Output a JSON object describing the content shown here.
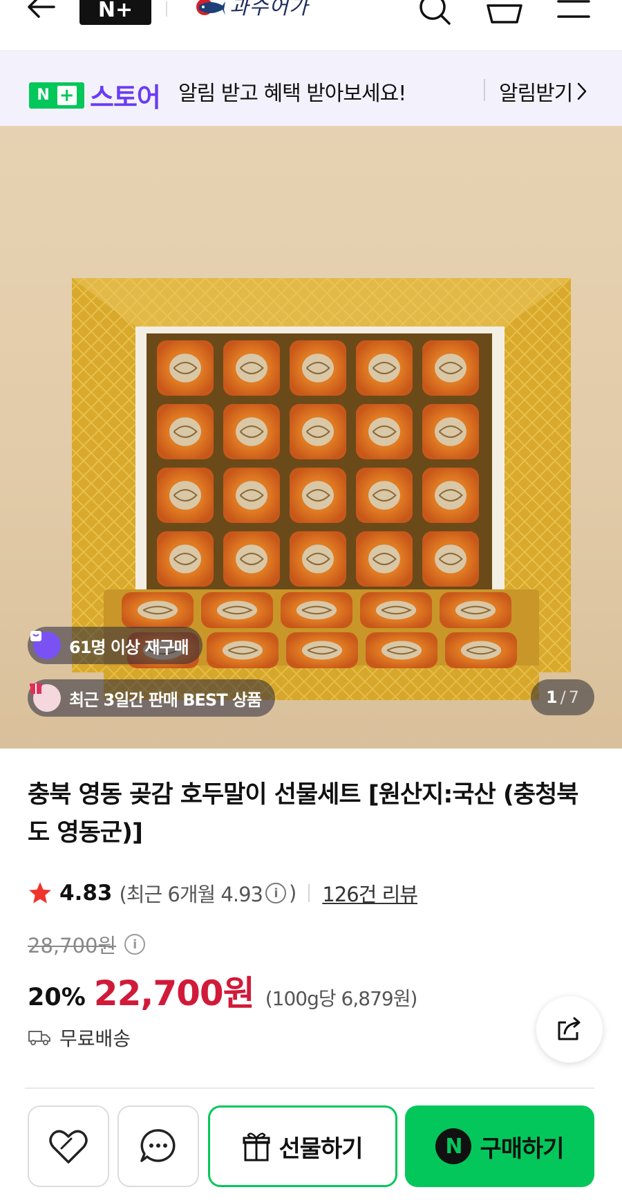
{
  "topnav": {
    "nplus_label": "N+",
    "brand_name": "과수어가",
    "icons": [
      "back-arrow-icon",
      "search-icon",
      "cart-icon",
      "menu-icon"
    ]
  },
  "banner": {
    "logo_n": "N",
    "logo_plus": "+",
    "logo_store": "스토어",
    "message": "알림 받고 혜택 받아보세요!",
    "action": "알림받기"
  },
  "hero": {
    "pill_repurchase": "61명 이상 재구매",
    "pill_best": "최근 3일간 판매 BEST 상품",
    "counter_current": "1",
    "counter_sep": "/",
    "counter_total": "7"
  },
  "product": {
    "title": "충북 영동 곶감 호두말이 선물세트 [원산지:국산 (충청북도 영동군)]",
    "rating": "4.83",
    "rating_recent_prefix": "(최근 6개월 4.93",
    "rating_recent_suffix": ")",
    "review_link": "126건 리뷰",
    "original_price": "28,700원",
    "discount": "20%",
    "price": "22,700원",
    "unit_price": "(100g당 6,879원)",
    "shipping": "무료배송"
  },
  "actions": {
    "gift_label": "선물하기",
    "buy_label": "구매하기",
    "buy_badge": "N"
  },
  "colors": {
    "naver_green": "#03c75a",
    "store_purple": "#6a3cf5",
    "price_red": "#d11a3a",
    "banner_bg": "#f3f2fc"
  }
}
